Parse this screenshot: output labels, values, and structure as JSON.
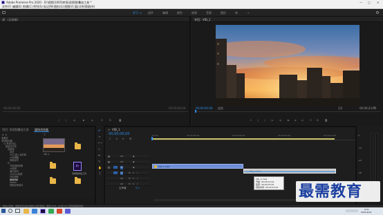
{
  "app": {
    "title": "Adobe Premiere Pro 2020 - D:\\视频\\1005\\转场\\双视频\\叠加工具 *"
  },
  "window_controls": {
    "minimize": "—",
    "maximize": "□",
    "close": "✕"
  },
  "menu": [
    "文件(F)",
    "编辑(E)",
    "剪辑(C)",
    "序列(S)",
    "标记(M)",
    "图形(G)",
    "视图(V)",
    "窗口(W)",
    "帮助(H)"
  ],
  "workspaces": [
    "学习",
    "组件",
    "编辑",
    "颜色",
    "效果",
    "音频",
    "图形",
    "库"
  ],
  "active_workspace": "学习",
  "source_monitor": {
    "tab": "源：(无剪辑)",
    "timecode_left": "00;00;00;00",
    "timecode_right": "00;00;00;00"
  },
  "program_monitor": {
    "tab": "节目：VID_1",
    "timecode": "00;00;00;00",
    "fit": "适合",
    "quality": "1/2",
    "duration": "00;00;23;05"
  },
  "project_panel": {
    "tabs": [
      "项目: 双视频叠加工具",
      "媒体浏览器"
    ],
    "active_tab": "媒体浏览器",
    "tree": [
      "收藏夹",
      "本地驱动器",
      "C:(系统分区)",
      "新建文件夹",
      "百度网",
      "素材",
      "2021新入素材库",
      "xx热播剧",
      "视频素材",
      "D:",
      "文档视频剪辑",
      "xx装修",
      "演示素材",
      "2020xx视频",
      "开发视频",
      "Apache",
      "Adobe",
      "视频剪辑素材"
    ],
    "files": [
      {
        "name": "VID_1",
        "type": "thumbnail"
      },
      {
        "name": "",
        "type": "folder"
      },
      {
        "name": "",
        "type": "folder"
      },
      {
        "name": "双视频叠加工具",
        "type": "premiere-project"
      },
      {
        "name": "",
        "type": "folder"
      },
      {
        "name": "",
        "type": "folder"
      }
    ]
  },
  "timeline": {
    "sequence_tab": "VID_1",
    "timecode": "00;00;00;00",
    "ruler": [
      "00;00",
      "00;00;04;29",
      "00;00;09;29",
      "00;00;14;29",
      "00;00;19;29"
    ],
    "tracks": [
      {
        "id": "V3",
        "kind": "video"
      },
      {
        "id": "V2",
        "kind": "video"
      },
      {
        "id": "V1",
        "kind": "video"
      },
      {
        "id": "A1",
        "kind": "audio"
      },
      {
        "id": "A2",
        "kind": "audio"
      },
      {
        "id": "A3",
        "kind": "audio"
      }
    ],
    "master": "主声道",
    "master_value": "0.0",
    "clip_v1": "VID_1.mp4",
    "clip_v2": "VID_2.mp4",
    "tooltip": [
      "VID_2.mp4",
      "开始: 00;00;11;04",
      "结束: 00;00;23;05",
      "持续时间: 00;00;12;02"
    ]
  },
  "meters": {
    "labels": [
      "0",
      "-12",
      "-24",
      "-36",
      "-48",
      "dB"
    ]
  },
  "status": {
    "text": "单击以选择，或单击空白处并拖动以进行框选。使用 Shift、Alt 和 Ctrl 可获得其他选项。"
  },
  "watermark": {
    "text": "最需教育"
  },
  "taskbar": {
    "time": "9:31",
    "date": "2021/9/24"
  },
  "colors": {
    "accent": "#2d8ceb",
    "clip_video": "#6e8fd6",
    "folder": "#e9b647"
  }
}
